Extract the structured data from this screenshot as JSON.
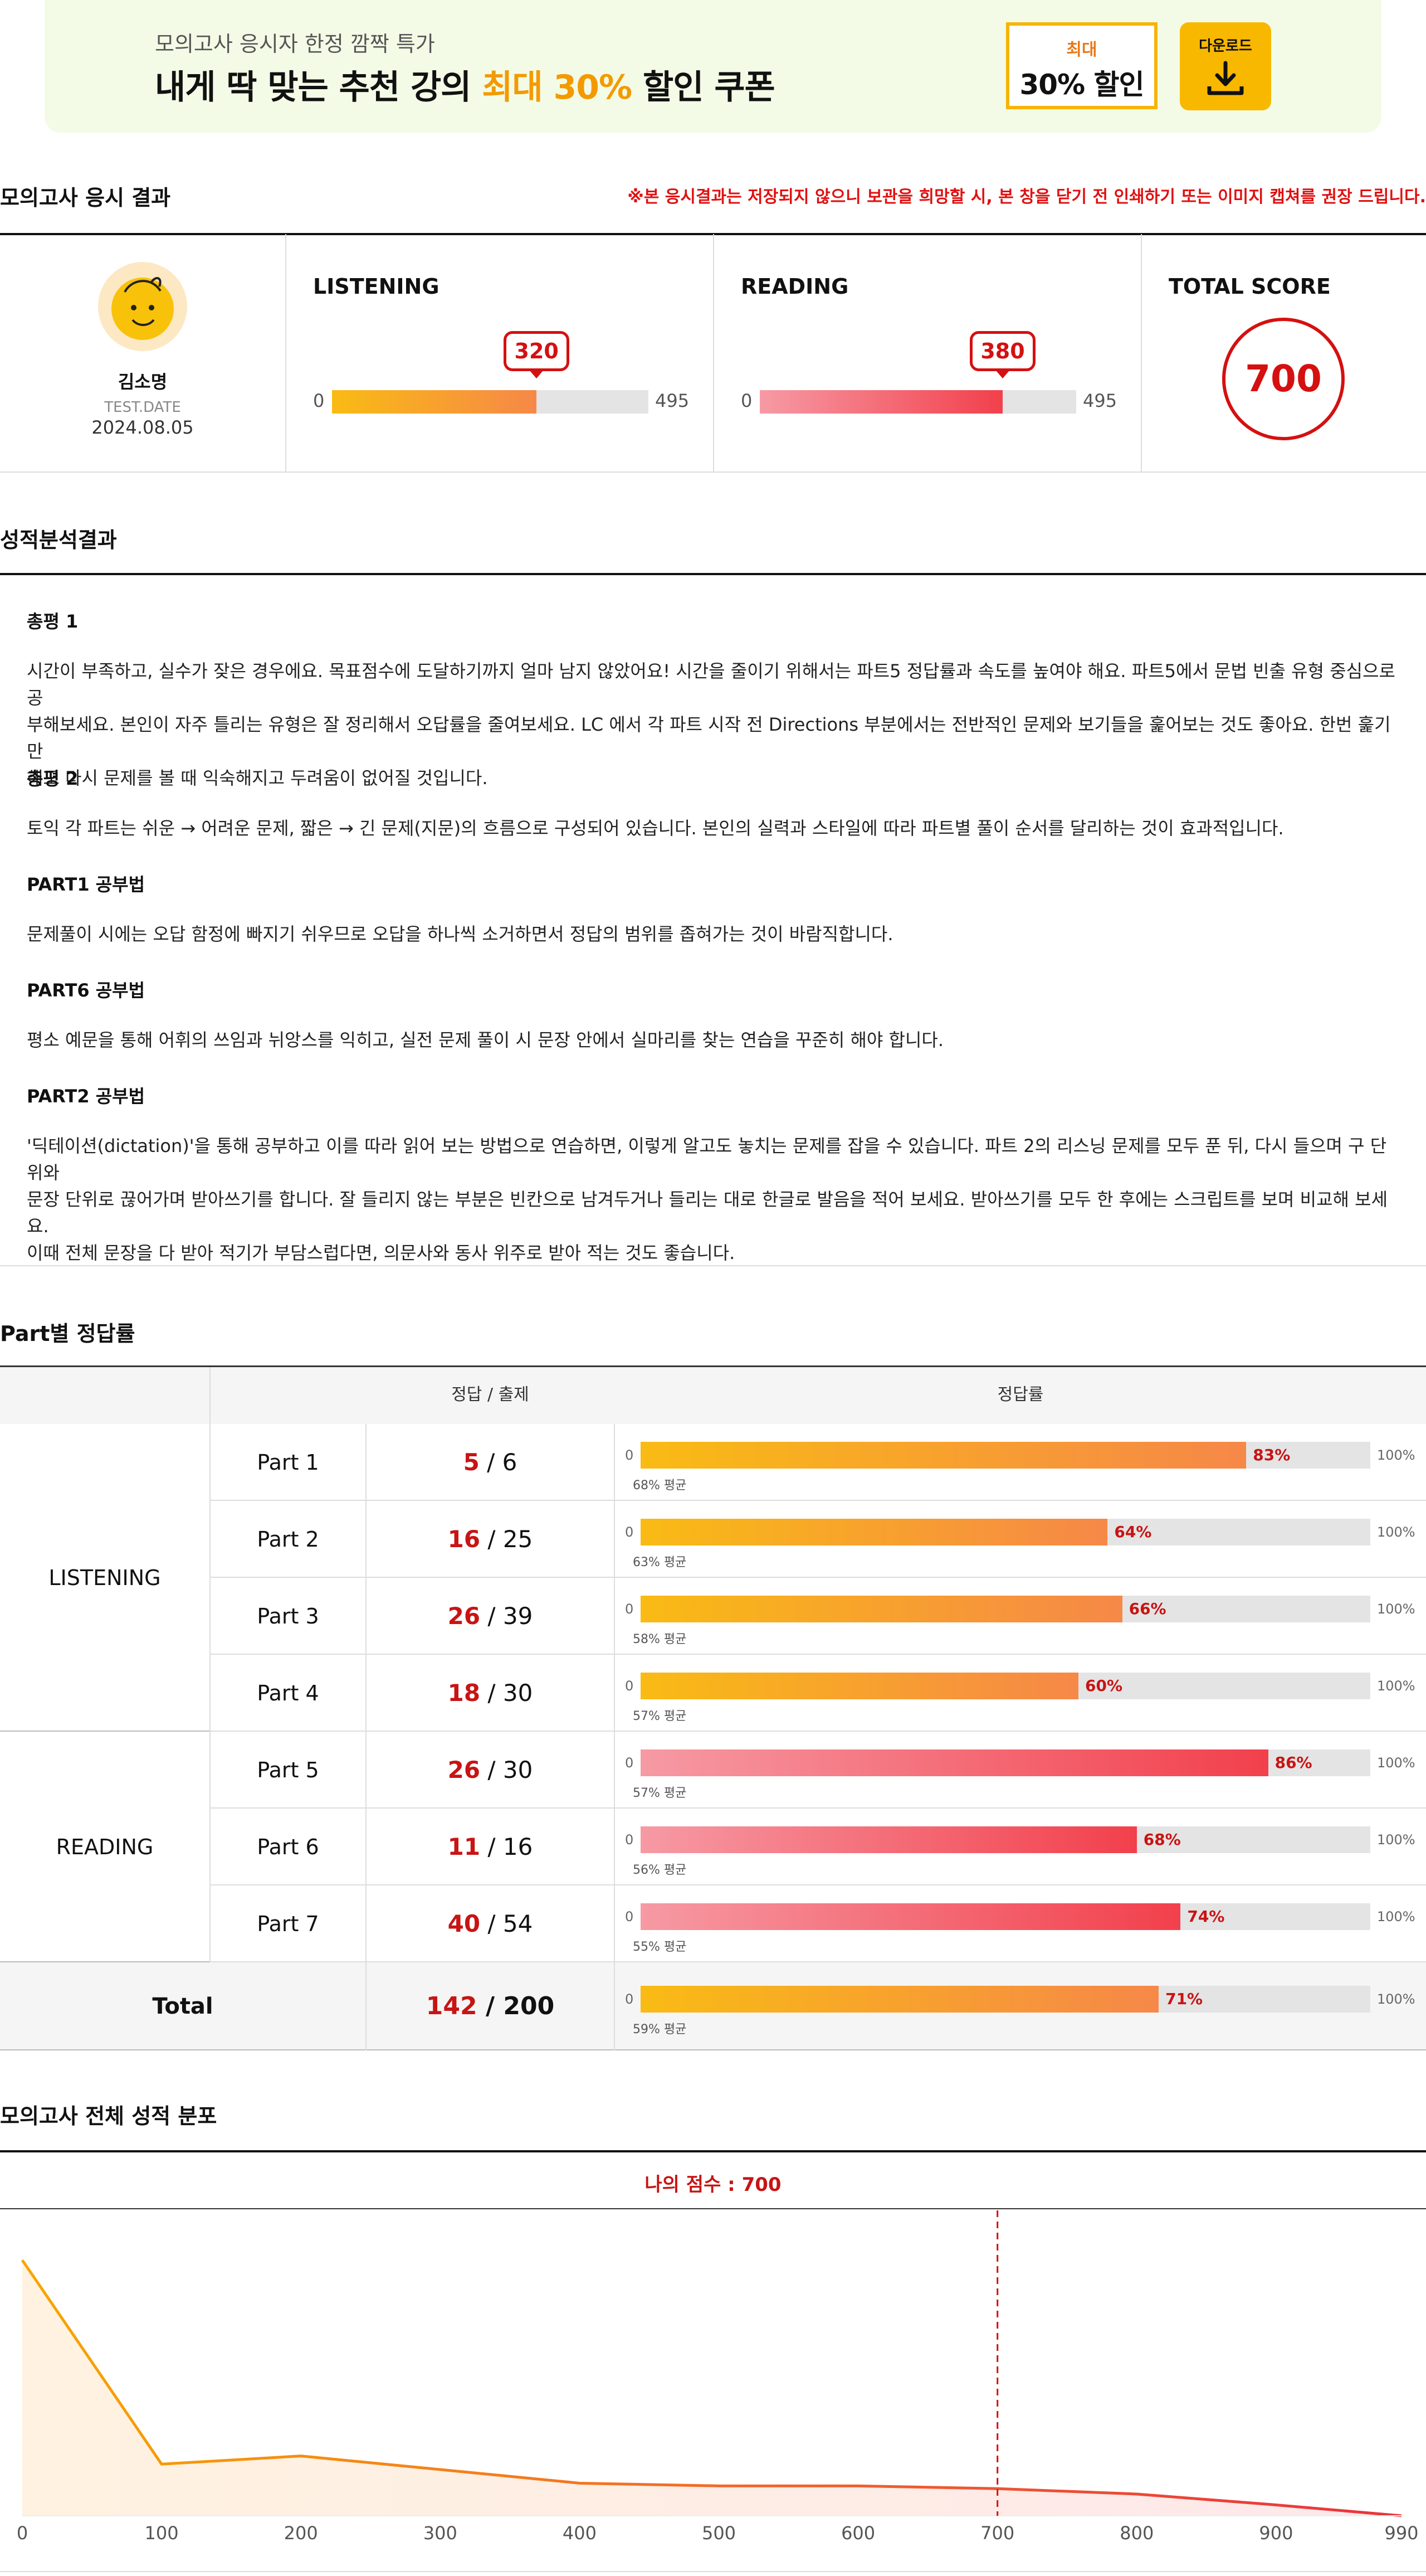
{
  "banner": {
    "subtitle": "모의고사 응시자 한정 깜짝 특가",
    "title_pre": "내게 딱 맞는 추천 강의 ",
    "title_highlight": "최대 30%",
    "title_post": " 할인 쿠폰",
    "coupon_top": "최대",
    "coupon_main": "30% 할인",
    "download_label": "다운로드",
    "accent": "#f39a00"
  },
  "result": {
    "title": "모의고사 응시 결과",
    "notice": "※본 응시결과는 저장되지 않으니 보관을 희망할 시, 본 창을 닫기 전 인쇄하기 또는 이미지 캡쳐를 권장 드립니다.",
    "user_name": "김소명",
    "test_date_label": "TEST.DATE",
    "test_date": "2024.08.05",
    "listening_label": "LISTENING",
    "listening_score": 320,
    "reading_label": "READING",
    "reading_score": 380,
    "min_label": "0",
    "max_label": "495",
    "max_score": 495,
    "total_label": "TOTAL SCORE",
    "total_score": "700"
  },
  "analysis": {
    "title": "성적분석결과",
    "items": [
      {
        "heading": "총평 1",
        "lines": [
          "시간이 부족하고, 실수가 잦은 경우에요. 목표점수에 도달하기까지 얼마 남지 않았어요! 시간을 줄이기 위해서는 파트5 정답률과 속도를 높여야 해요. 파트5에서 문법 빈출 유형 중심으로 공",
          "부해보세요. 본인이 자주 틀리는 유형은 잘 정리해서 오답률을 줄여보세요. LC 에서 각 파트 시작 전 Directions 부분에서는 전반적인 문제와 보기들을 훑어보는 것도 좋아요. 한번 훑기만",
          "해도 다시 문제를 볼 때 익숙해지고 두려움이 없어질 것입니다."
        ]
      },
      {
        "heading": "총평 2",
        "lines": [
          "토익 각 파트는 쉬운 → 어려운 문제, 짧은 → 긴 문제(지문)의 흐름으로 구성되어 있습니다. 본인의 실력과 스타일에 따라 파트별 풀이 순서를 달리하는 것이 효과적입니다."
        ]
      },
      {
        "heading": "PART1 공부법",
        "lines": [
          "문제풀이 시에는 오답 함정에 빠지기 쉬우므로 오답을 하나씩 소거하면서 정답의 범위를 좁혀가는 것이 바람직합니다."
        ]
      },
      {
        "heading": "PART6 공부법",
        "lines": [
          "평소 예문을 통해 어휘의 쓰임과 뉘앙스를 익히고, 실전 문제 풀이 시 문장 안에서 실마리를 찾는 연습을 꾸준히 해야 합니다."
        ]
      },
      {
        "heading": "PART2 공부법",
        "lines": [
          "'딕테이션(dictation)'을 통해 공부하고 이를 따라 읽어 보는 방법으로 연습하면, 이렇게 알고도 놓치는 문제를 잡을 수 있습니다. 파트 2의 리스닝 문제를 모두 푼 뒤, 다시 들으며 구 단위와",
          "문장 단위로 끊어가며 받아쓰기를 합니다. 잘 들리지 않는 부분은 빈칸으로 남겨두거나 들리는 대로 한글로 발음을 적어 보세요. 받아쓰기를 모두 한 후에는 스크립트를 보며 비교해 보세요.",
          "이때 전체 문장을 다 받아 적기가 부담스럽다면, 의문사와 동사 위주로 받아 적는 것도 좋습니다."
        ]
      }
    ]
  },
  "parts": {
    "title": "Part별 정답률",
    "col_correct": "정답 / 출제",
    "col_rate": "정답률",
    "listening_group": "LISTENING",
    "reading_group": "READING",
    "bar_min": "0",
    "bar_max": "100%",
    "avg_suffix": "평균",
    "rows": [
      {
        "name": "Part 1",
        "correct": "5",
        "total": "6",
        "rate": 83,
        "rate_label": "83%",
        "avg_label": "68% 평균",
        "section": "L"
      },
      {
        "name": "Part 2",
        "correct": "16",
        "total": "25",
        "rate": 64,
        "rate_label": "64%",
        "avg_label": "63% 평균",
        "section": "L"
      },
      {
        "name": "Part 3",
        "correct": "26",
        "total": "39",
        "rate": 66,
        "rate_label": "66%",
        "avg_label": "58% 평균",
        "section": "L"
      },
      {
        "name": "Part 4",
        "correct": "18",
        "total": "30",
        "rate": 60,
        "rate_label": "60%",
        "avg_label": "57% 평균",
        "section": "L"
      },
      {
        "name": "Part 5",
        "correct": "26",
        "total": "30",
        "rate": 86,
        "rate_label": "86%",
        "avg_label": "57% 평균",
        "section": "R"
      },
      {
        "name": "Part 6",
        "correct": "11",
        "total": "16",
        "rate": 68,
        "rate_label": "68%",
        "avg_label": "56% 평균",
        "section": "R"
      },
      {
        "name": "Part 7",
        "correct": "40",
        "total": "54",
        "rate": 74,
        "rate_label": "74%",
        "avg_label": "55% 평균",
        "section": "R"
      }
    ],
    "total": {
      "name": "Total",
      "correct": "142",
      "total": "200",
      "rate": 71,
      "rate_label": "71%",
      "avg_label": "59% 평균"
    }
  },
  "distribution": {
    "title": "모의고사 전체 성적 분포",
    "my_score_label": "나의 점수 : 700"
  },
  "chart_data": {
    "type": "area",
    "title": "",
    "xlabel": "",
    "ylabel": "",
    "x": [
      0,
      100,
      200,
      300,
      400,
      500,
      600,
      700,
      800,
      900,
      990
    ],
    "y": [
      94,
      19,
      22,
      17,
      12,
      11,
      11,
      10,
      8,
      4,
      0
    ],
    "xticks": [
      "0",
      "100",
      "200",
      "300",
      "400",
      "500",
      "600",
      "700",
      "800",
      "900",
      "990"
    ],
    "xlim": [
      0,
      990
    ],
    "ylim": [
      0,
      100
    ],
    "marker_x": 700,
    "line_colors": [
      "#f7a600",
      "#f26a2a",
      "#e8343c"
    ],
    "fill_color": "#fff2e0",
    "marker_color": "#d51010"
  }
}
